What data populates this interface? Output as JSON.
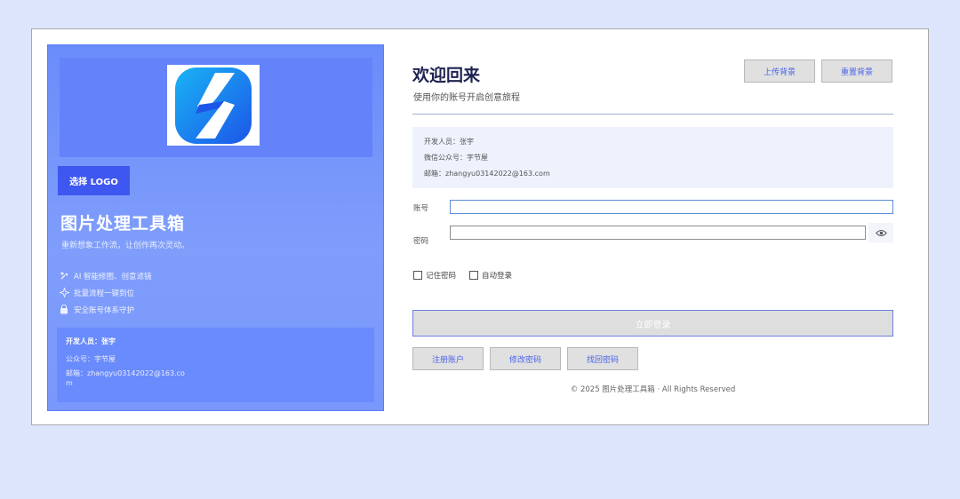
{
  "brand": {
    "choose_logo_label": "选择 LOGO",
    "title": "图片处理工具箱",
    "subtitle": "重新想象工作流，让创作再次灵动。",
    "features": [
      {
        "icon": "magic-icon",
        "label": "AI 智能修图、创意滤镜"
      },
      {
        "icon": "sparkle-icon",
        "label": "批量流程一键到位"
      },
      {
        "icon": "shield-icon",
        "label": "安全账号体系守护"
      }
    ],
    "developer_card": {
      "developer": "开发人员：张宇",
      "official_account": "公众号：字节屋",
      "email": "邮箱：zhangyu03142022@163.com"
    }
  },
  "header": {
    "title": "欢迎回来",
    "subtitle": "使用你的账号开启创意旅程",
    "upload_bg_label": "上传背景",
    "reset_bg_label": "重置背景"
  },
  "info": {
    "developer": "开发人员：张宇",
    "wechat": "微信公众号：字节屋",
    "email": "邮箱：zhangyu03142022@163.com"
  },
  "form": {
    "account_label": "账号",
    "account_value": "",
    "password_label": "密码",
    "password_value": "",
    "remember_label": "记住密码",
    "auto_login_label": "自动登录",
    "login_label": "立即登录"
  },
  "actions": {
    "register_label": "注册账户",
    "change_password_label": "修改密码",
    "recover_password_label": "找回密码"
  },
  "footer": {
    "copyright": "© 2025 图片处理工具箱 · All Rights Reserved"
  },
  "colors": {
    "page_bg": "#dde5fd",
    "brand_panel": "#7a98fb",
    "accent": "#3e57f0",
    "link_text": "#4a63e6"
  }
}
